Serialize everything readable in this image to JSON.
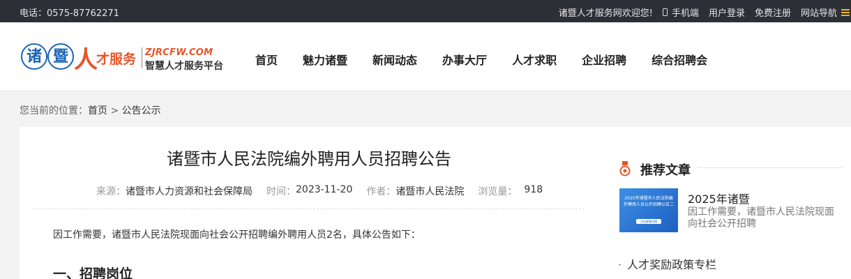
{
  "topbar": {
    "phone": "电话：0575-87762271",
    "welcome": "诸暨人才服务网欢迎您!",
    "mobile": "手机端",
    "login": "用户登录",
    "register": "免费注册",
    "sitenav": "网站导航"
  },
  "logo": {
    "char1": "诸",
    "char2": "暨",
    "char3": "人",
    "text": "才服务",
    "url": "ZJRCFW.COM",
    "slogan": "智慧人才服务平台"
  },
  "nav": [
    "首页",
    "魅力诸暨",
    "新闻动态",
    "办事大厅",
    "人才求职",
    "企业招聘",
    "综合招聘会"
  ],
  "breadcrumb": {
    "prefix": "您当前的位置：",
    "home": "首页",
    "sep": ">",
    "current": "公告公示"
  },
  "article": {
    "title": "诸暨市人民法院编外聘用人员招聘公告",
    "meta": {
      "source_label": "来源：",
      "source": "诸暨市人力资源和社会保障局",
      "time_label": "时间：",
      "time": "2023-11-20",
      "author_label": "作者：",
      "author": "诸暨市人民法院",
      "views_label": "浏览量：",
      "views": "918"
    },
    "intro": "因工作需要，诸暨市人民法院现面向社会公开招聘编外聘用人员2名，具体公告如下：",
    "section1": "一、招聘岗位"
  },
  "sidebar": {
    "title": "推荐文章",
    "rec": {
      "thumb_text": "2025年诸暨市人民法院编外聘用人员公开招聘公告二",
      "thumb_btn": "点击查看详情",
      "title": "2025年诸暨",
      "desc": "因工作需要，诸暨市人民法院现面向社会公开招聘"
    },
    "link": "人才奖励政策专栏",
    "link_bullet": "·"
  }
}
